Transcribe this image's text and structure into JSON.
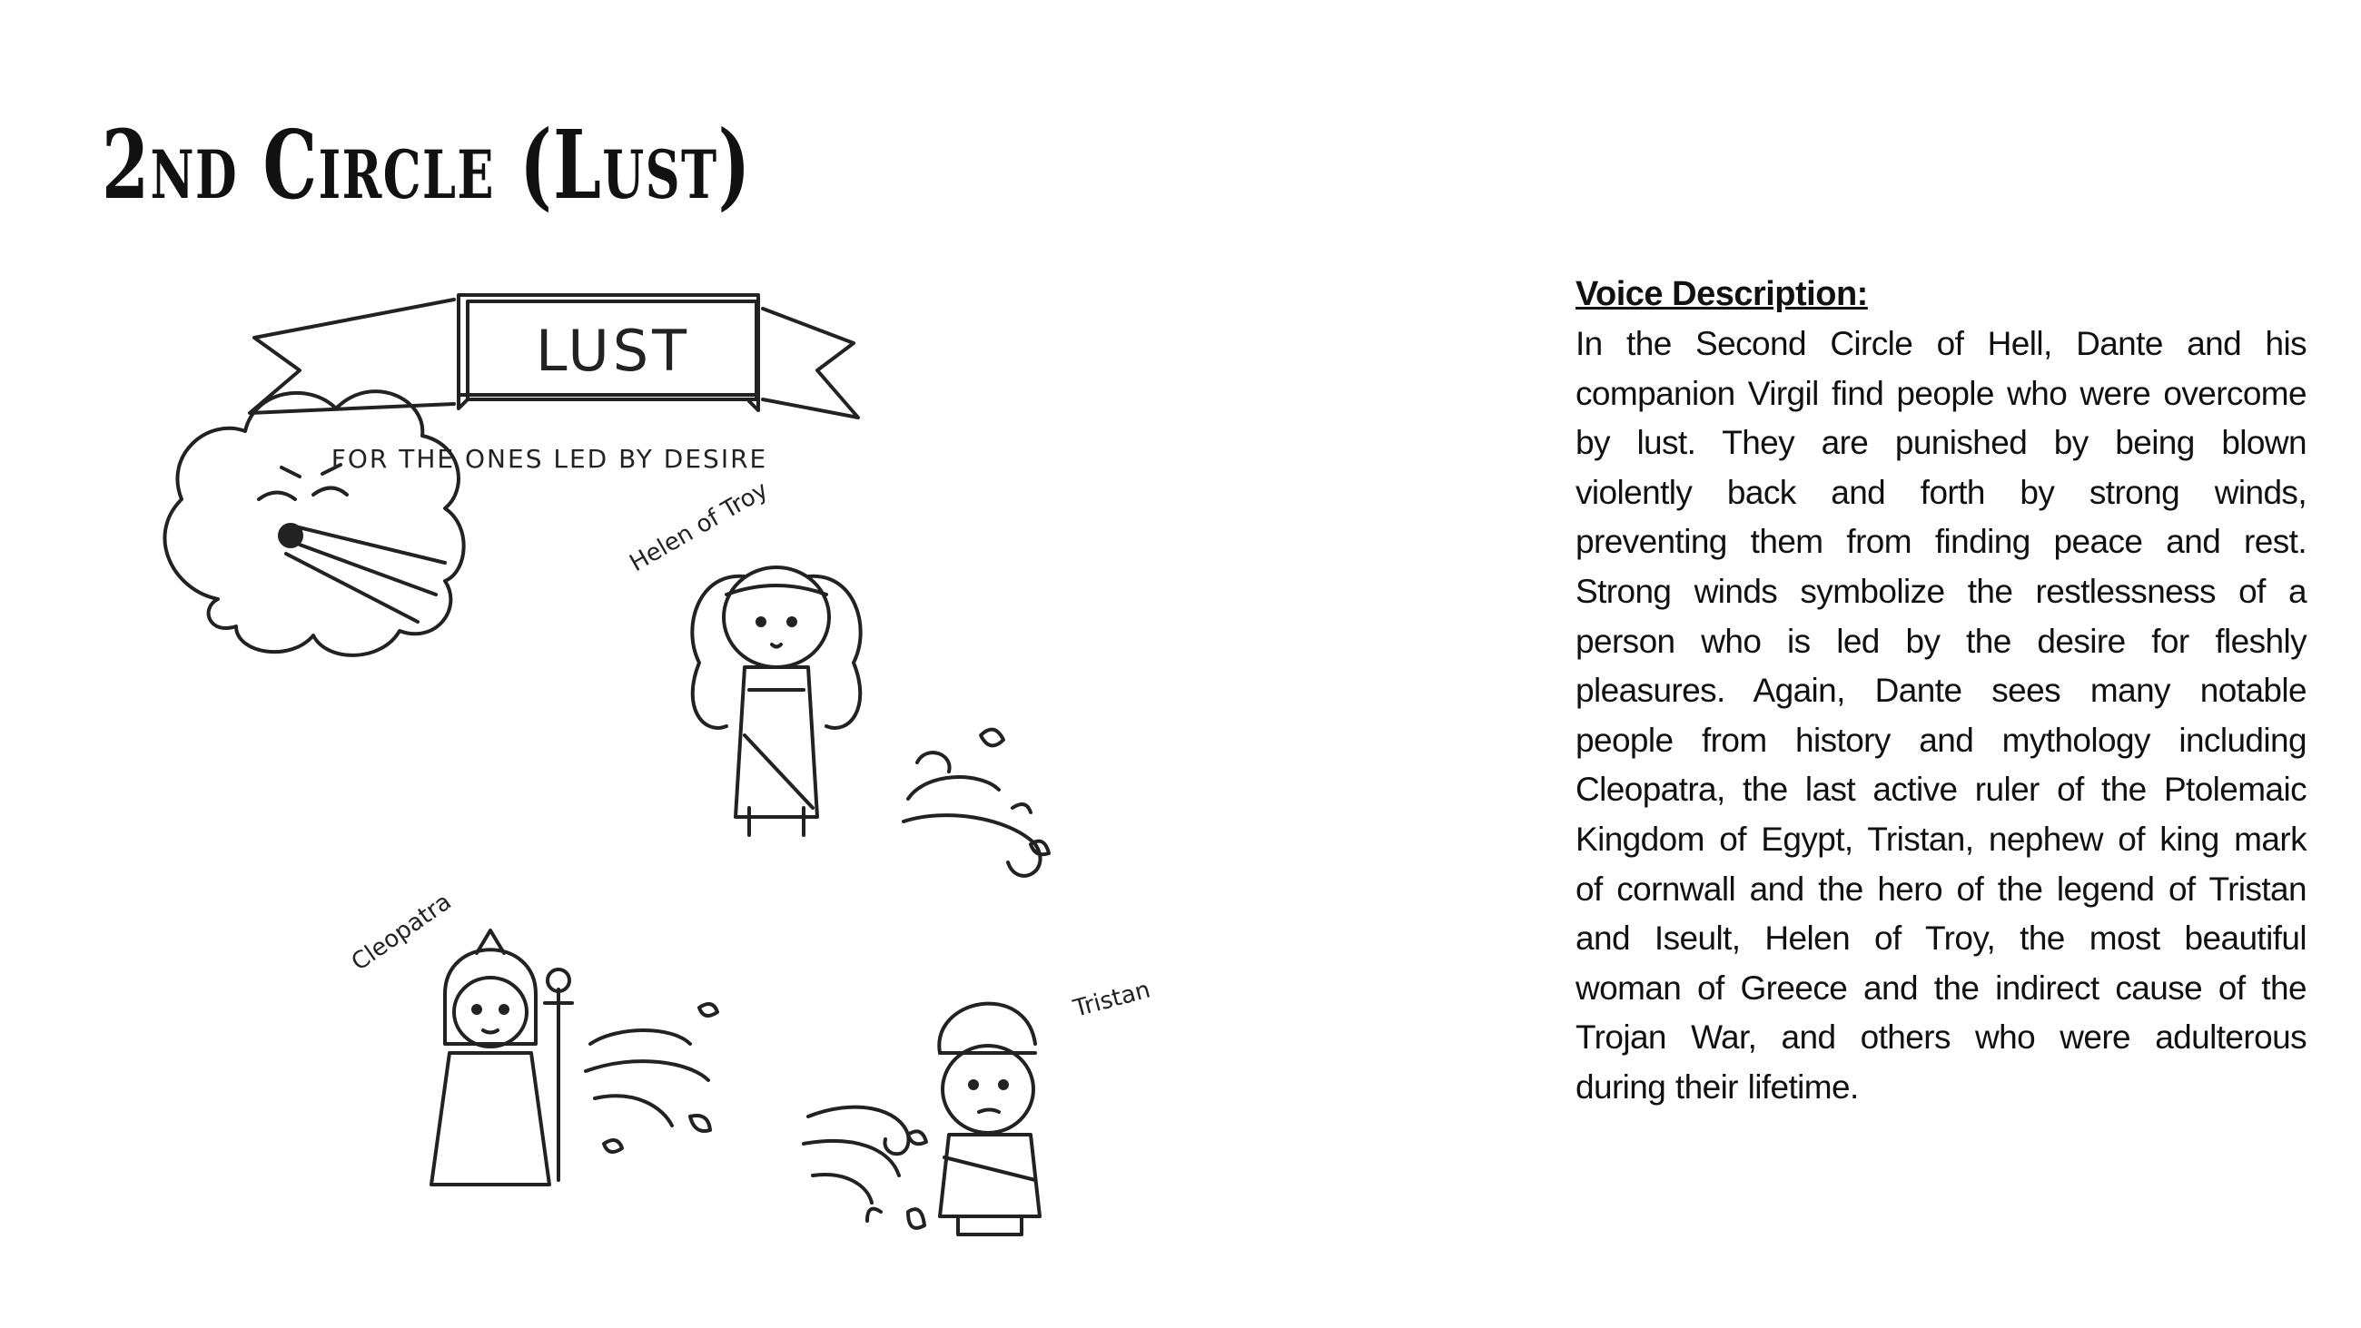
{
  "page": {
    "title": "2nd Circle (Lust)"
  },
  "illustration": {
    "banner_text": "LUST",
    "banner_caption": "FOR THE ONES LED BY DESIRE",
    "labels": {
      "helen": "Helen of Troy",
      "cleopatra": "Cleopatra",
      "tristan": "Tristan"
    }
  },
  "voice_description": {
    "heading": "Voice Description:",
    "body": "In the Second Circle of Hell, Dante and his companion Virgil find people who were overcome by lust. They are punished by being blown violently back and forth by strong winds, preventing them from finding peace and rest. Strong winds symbolize the restlessness of a person who is led by the desire for fleshly pleasures. Again, Dante sees many notable people from history and mythology including Cleopatra, the last active ruler of the Ptolemaic Kingdom of Egypt,  Tristan, nephew of king mark of cornwall and the hero of the legend of Tristan and Iseult, Helen of Troy, the most beautiful woman of Greece and the indirect cause of the Trojan War, and others who were adulterous during their lifetime."
  }
}
